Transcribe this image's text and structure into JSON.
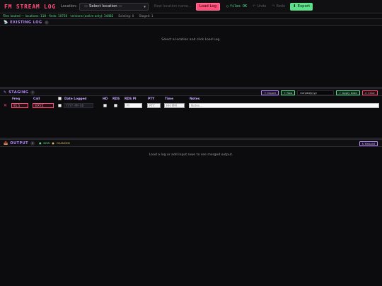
{
  "header": {
    "title": "FM STREAM LOG",
    "location_label": "Location:",
    "location_select": "— Select location —",
    "new_location_placeholder": "New location name...",
    "load_button": "Load Log",
    "files_ok": "files OK",
    "undo": "Undo",
    "redo": "Redo",
    "export": "Export"
  },
  "status": {
    "loaded": "Files loaded — locations: 118 · finds: 10750 · versions (active only): 34482",
    "existing": "Existing: 0",
    "staged": "Staged: 1"
  },
  "existing_log": {
    "title": "EXISTING LOG",
    "count": "0",
    "empty_message": "Select a location and click Load Log."
  },
  "staging": {
    "title": "STAGING",
    "count": "1",
    "import_label": "Import",
    "add_row_label": "+ Row",
    "date_placeholder": "mm/dd/yyyy",
    "apply_date_label": "✓ Apply Date",
    "clear_label": "× Clear",
    "columns": [
      "Freq",
      "Call",
      "Date Logged",
      "HD",
      "RDS",
      "RDS PI",
      "PTY",
      "Time",
      "Notes"
    ],
    "row": {
      "freq_placeholder": "91.5",
      "call_placeholder": "WXYZ",
      "date_placeholder": "YYYY-MM-DD",
      "rds_pi_placeholder": "PI",
      "pty_placeholder": "PTY",
      "time_placeholder": "HH:MM",
      "notes_placeholder": "Notes..."
    }
  },
  "output": {
    "title": "OUTPUT",
    "count": "0",
    "legend_new": "NEW",
    "legend_changed": "CHANGED",
    "rebuild_label": "Rebuild",
    "empty_message": "Load a log or add input rows to see merged output."
  },
  "colors": {
    "accent": "#ff4f7a",
    "purple": "#b68cff",
    "green": "#5ee08a"
  }
}
